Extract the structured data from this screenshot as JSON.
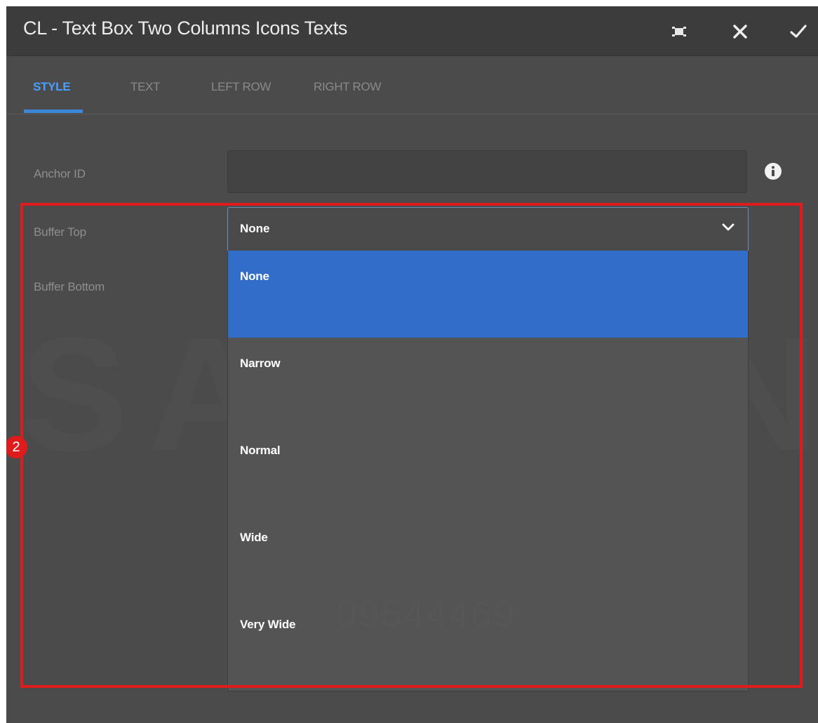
{
  "dialog": {
    "title": "CL - Text Box Two Columns Icons Texts",
    "toolbar": {
      "fullscreen_icon": "fullscreen-icon",
      "close_icon": "close-icon",
      "confirm_icon": "check-icon"
    }
  },
  "tabs": [
    {
      "label": "STYLE",
      "active": true
    },
    {
      "label": "TEXT",
      "active": false
    },
    {
      "label": "LEFT ROW",
      "active": false
    },
    {
      "label": "RIGHT ROW",
      "active": false
    }
  ],
  "form": {
    "anchor_id": {
      "label": "Anchor ID",
      "value": "",
      "info_icon": "info-icon"
    },
    "buffer_top": {
      "label": "Buffer Top",
      "value": "None"
    },
    "buffer_bottom": {
      "label": "Buffer Bottom"
    }
  },
  "dropdown": {
    "options": [
      "None",
      "Narrow",
      "Normal",
      "Wide",
      "Very Wide"
    ],
    "selected_index": 0
  },
  "watermark": {
    "brand": "SAMSUNG",
    "id": "09544469"
  },
  "annotation": {
    "step_number": "2",
    "color": "#e01b1b"
  },
  "colors": {
    "accent": "#3d87d8",
    "selected_option": "#326ec9",
    "dialog_bg": "#4b4b4b"
  }
}
